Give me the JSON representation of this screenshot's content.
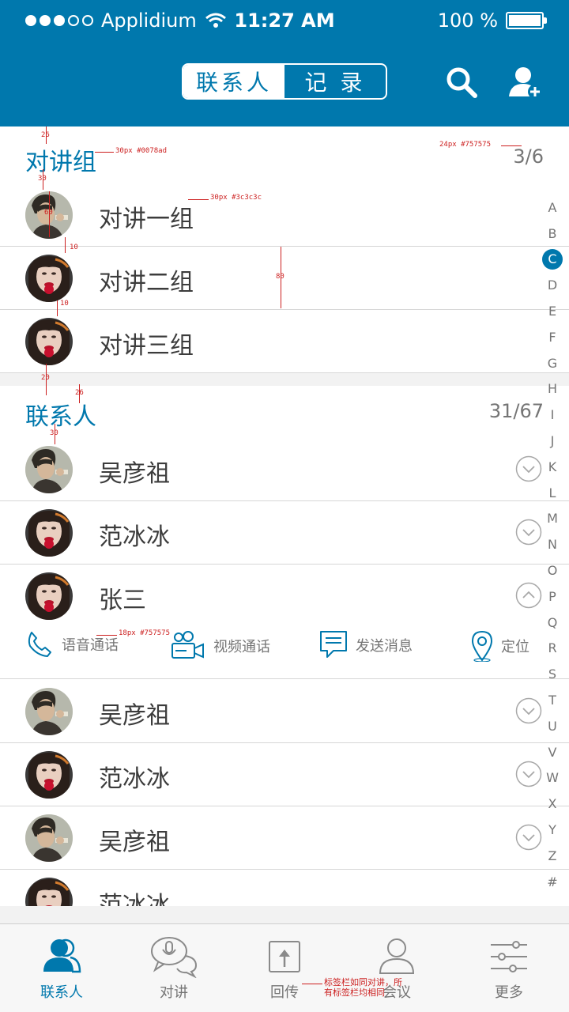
{
  "status_bar": {
    "carrier": "Applidium",
    "time": "11:27 AM",
    "battery": "100 %"
  },
  "header": {
    "tabs": [
      {
        "label": "联系人",
        "active": true
      },
      {
        "label": "记 录",
        "active": false
      }
    ]
  },
  "groups_section": {
    "title": "对讲组",
    "count": "3/6",
    "items": [
      {
        "name": "对讲一组"
      },
      {
        "name": "对讲二组"
      },
      {
        "name": "对讲三组"
      }
    ]
  },
  "contacts_section": {
    "title": "联系人",
    "count": "31/67",
    "items": [
      {
        "name": "吴彦祖"
      },
      {
        "name": "范冰冰"
      },
      {
        "name": "张三"
      },
      {
        "name": "吴彦祖"
      },
      {
        "name": "范冰冰"
      },
      {
        "name": "吴彦祖"
      },
      {
        "name": "范冰冰"
      }
    ]
  },
  "actions": [
    {
      "label": "语音通话"
    },
    {
      "label": "视频通话"
    },
    {
      "label": "发送消息"
    },
    {
      "label": "定位"
    }
  ],
  "index_letters": [
    "A",
    "B",
    "C",
    "D",
    "E",
    "F",
    "G",
    "H",
    "I",
    "J",
    "K",
    "L",
    "M",
    "N",
    "O",
    "P",
    "Q",
    "R",
    "S",
    "T",
    "U",
    "V",
    "W",
    "X",
    "Y",
    "Z",
    "#"
  ],
  "index_active": "C",
  "tabbar": [
    {
      "label": "联系人",
      "active": true
    },
    {
      "label": "对讲"
    },
    {
      "label": "回传"
    },
    {
      "label": "会议"
    },
    {
      "label": "更多"
    }
  ],
  "annotations": {
    "title_spec": "30px #0078ad",
    "count_spec": "24px #757575",
    "name_spec": "30px #3c3c3c",
    "action_spec": "18px #757575",
    "d26a": "26",
    "d30a": "30",
    "d60": "60",
    "d10a": "10",
    "d80": "80",
    "d10b": "10",
    "d20": "20",
    "d26b": "26",
    "d30b": "30",
    "tab_note": "标签栏如同对讲，所有标签栏均相同"
  },
  "colors": {
    "primary": "#0078ad",
    "text": "#3c3c3c",
    "secondary": "#757575",
    "annotation": "#cc1f1f"
  }
}
